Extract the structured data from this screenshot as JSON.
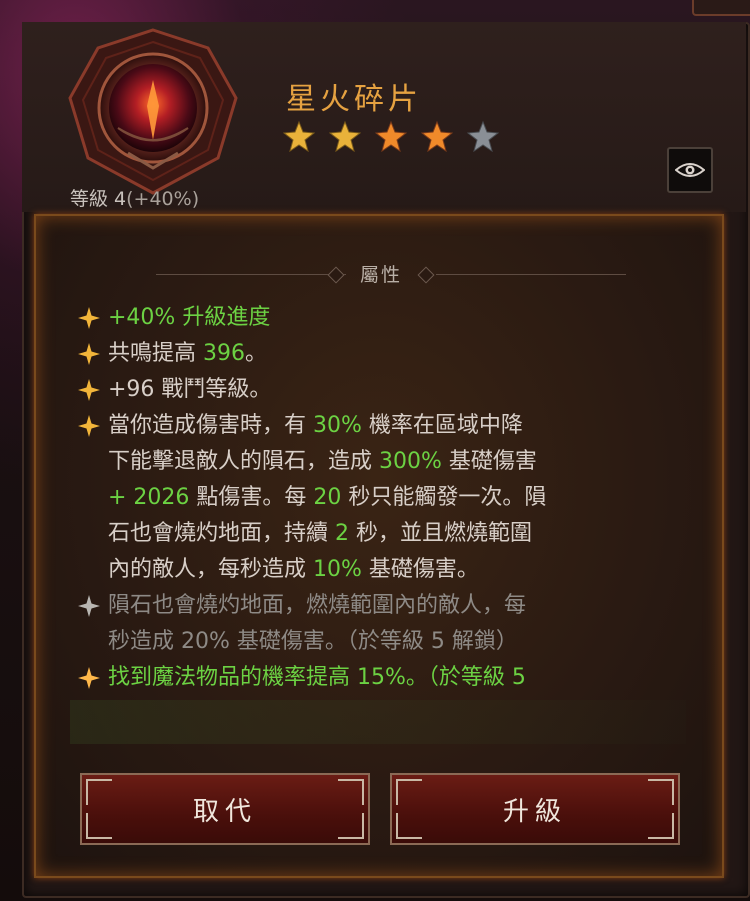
{
  "item": {
    "name": "星火碎片",
    "stars_total": 5,
    "stars_filled": 4,
    "level_label": "等級 4",
    "level_bonus": "(+40%)"
  },
  "section": {
    "title": "屬性"
  },
  "affixes": [
    {
      "state": "active",
      "parts": [
        {
          "t": "+40% 升級進度",
          "c": "g"
        }
      ]
    },
    {
      "state": "active",
      "parts": [
        {
          "t": "共鳴提高 "
        },
        {
          "t": "396",
          "c": "g"
        },
        {
          "t": "。"
        }
      ]
    },
    {
      "state": "active",
      "parts": [
        {
          "t": "+96 戰鬥等級。"
        }
      ]
    },
    {
      "state": "active",
      "lines": [
        [
          {
            "t": "當你造成傷害時，有 "
          },
          {
            "t": "30%",
            "c": "g"
          },
          {
            "t": " 機率在區域中降"
          }
        ],
        [
          {
            "t": "下能擊退敵人的隕石，造成 "
          },
          {
            "t": "300%",
            "c": "g"
          },
          {
            "t": " 基礎傷害"
          }
        ],
        [
          {
            "t": "+ 2026",
            "c": "g"
          },
          {
            "t": " 點傷害。每 "
          },
          {
            "t": "20",
            "c": "g"
          },
          {
            "t": " 秒只能觸發一次。隕"
          }
        ],
        [
          {
            "t": "石也會燒灼地面，持續 "
          },
          {
            "t": "2",
            "c": "g"
          },
          {
            "t": " 秒，並且燃燒範圍"
          }
        ],
        [
          {
            "t": "內的敵人，每秒造成 "
          },
          {
            "t": "10%",
            "c": "g"
          },
          {
            "t": " 基礎傷害。"
          }
        ]
      ]
    },
    {
      "state": "locked",
      "lines": [
        [
          {
            "t": "隕石也會燒灼地面，燃燒範圍內的敵人，每"
          }
        ],
        [
          {
            "t": "秒造成 20% 基礎傷害。（於等級 5 解鎖）"
          }
        ]
      ]
    },
    {
      "state": "highlight",
      "lines": [
        [
          {
            "t": "找到魔法物品的機率提高 15%。（於等級 5"
          }
        ]
      ]
    }
  ],
  "buttons": {
    "replace_label": "取代",
    "upgrade_label": "升級"
  },
  "colors": {
    "title": "#e6a241",
    "green": "#6cd243",
    "star_gold": "#e9b23a",
    "star_orange": "#f08a2a",
    "star_empty": "#8a8f96",
    "button_red": "#5a1610"
  }
}
